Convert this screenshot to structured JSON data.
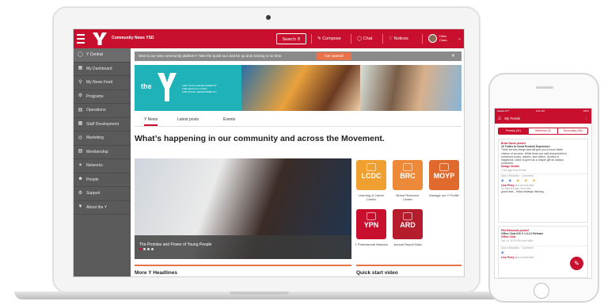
{
  "header": {
    "brand": "Community News YSD",
    "search_label": "Search",
    "compose_label": "Compose",
    "chat_label": "Chat",
    "notices_label": "Notices",
    "user_greeting": "Hello",
    "user_name": "Clara"
  },
  "sidebar": {
    "items": [
      {
        "label": "Y Central",
        "icon": "circle-y-icon"
      },
      {
        "label": "My Dashboard",
        "icon": "dashboard-icon"
      },
      {
        "label": "My News Feed",
        "icon": "pin-icon"
      },
      {
        "label": "Programs",
        "icon": "programs-icon"
      },
      {
        "label": "Operations",
        "icon": "operations-icon"
      },
      {
        "label": "Staff Development",
        "icon": "chart-icon"
      },
      {
        "label": "Marketing",
        "icon": "marketing-icon"
      },
      {
        "label": "Membership",
        "icon": "membership-icon"
      },
      {
        "label": "Networks",
        "icon": "networks-icon"
      },
      {
        "label": "People",
        "icon": "people-icon"
      },
      {
        "label": "Support",
        "icon": "support-icon"
      },
      {
        "label": "About the Y",
        "icon": "info-icon"
      }
    ]
  },
  "banner": {
    "text": "New to our new community platform? Take the quick tour and be up and running in no time.",
    "button": "Get started!",
    "close": "✕"
  },
  "hero": {
    "the": "the",
    "tagline": [
      "FOR YOUTH DEVELOPMENT®",
      "FOR HEALTHY LIVING",
      "FOR SOCIAL RESPONSIBILITY"
    ]
  },
  "tabs": [
    "Y News",
    "Latest posts",
    "Events"
  ],
  "headline": "What’s happening in our community and across the Movement.",
  "feature": {
    "caption": "The Promise and Power of Young People"
  },
  "apps": [
    {
      "abbr": "LCDC",
      "label": "Learning & Career Center",
      "color": "#f0a030"
    },
    {
      "abbr": "BRC",
      "label": "Brand Resource Center",
      "color": "#ec8a3a"
    },
    {
      "abbr": "MOYP",
      "label": "Manage our Y Profile",
      "color": "#e06a2e"
    },
    {
      "abbr": "YPN",
      "label": "Y Professional Network",
      "color": "#c8102e"
    },
    {
      "abbr": "ARD",
      "label": "Annual Report Data",
      "color": "#b51d2c"
    }
  ],
  "sections": {
    "headlines": "More Y Headlines",
    "video": "Quick start video"
  },
  "phone": {
    "status_left": "●●●●● ATT",
    "status_time": "9:41 AM",
    "status_right": "100%",
    "title": "My Feeds",
    "tabs": [
      "Primary (31)",
      "Mentions (3)",
      "Secondary (66)"
    ],
    "post1": {
      "author": "Brian Davis posted",
      "title": "10 Truths to Great Product Experience",
      "body": [
        "There are key things that will give you a much better",
        "chance of success. While these are well documented in",
        "numerous books, articles, and videos. Symbol of",
        "happiness, which is given as a unique gift on various",
        "occasions."
      ],
      "group": "Design Studio",
      "time": "4 hrs ago from Email",
      "reaction_prompt": "Add a Reaction · Comment",
      "commenter": "Lisa Perry",
      "commenter_action": "last commented",
      "comment_time": "32 minutes ago from web",
      "comment": "good read... helps strategic thinking..."
    },
    "post2": {
      "author": "Phil Edmonds posted",
      "title": "Office Chat iOS V 1.0.1.0 Release",
      "group": "Office Chat",
      "time": "Jan 14, 8:30 PM from Web",
      "reaction_prompt": "Add a Reaction · Comment",
      "commenter": "Lisa Perry",
      "commenter_action": "last commented"
    }
  }
}
